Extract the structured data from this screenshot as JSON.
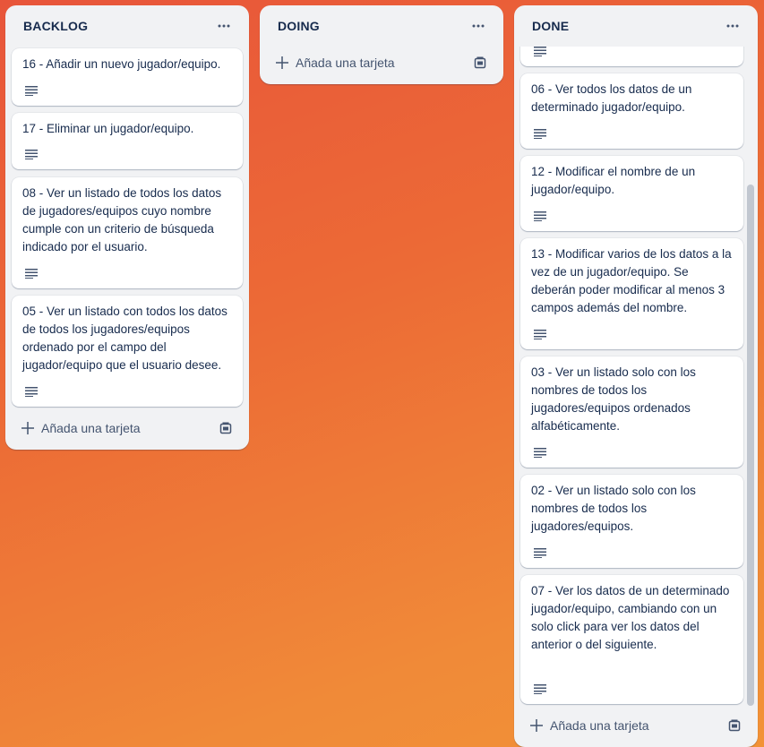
{
  "lists": [
    {
      "title": "BACKLOG",
      "add_label": "Añada una tarjeta",
      "cards": [
        "16 - Añadir un nuevo jugador/equipo.",
        "17 - Eliminar un jugador/equipo.",
        "08 - Ver un listado de todos los datos de jugadores/equipos cuyo nombre cumple con un criterio de búsqueda indicado por el usuario.",
        "05 - Ver un listado con todos los datos de todos los jugadores/equipos ordenado por el campo del jugador/equipo que el usuario desee."
      ]
    },
    {
      "title": "DOING",
      "add_label": "Añada una tarjeta",
      "cards": []
    },
    {
      "title": "DONE",
      "add_label": "Añada una tarjeta",
      "cards": [
        "06 - Ver todos los datos de un determinado jugador/equipo.",
        "12 - Modificar el nombre de un jugador/equipo.",
        "13 - Modificar varios de los datos a la vez de un jugador/equipo. Se deberán poder modificar al menos 3 campos además del nombre.",
        "03 - Ver un listado solo con los nombres de todos los jugadores/equipos ordenados alfabéticamente.",
        "02 - Ver un listado solo con los nombres de todos los jugadores/equipos.",
        "07 - Ver los datos de un determinado jugador/equipo, cambiando con un solo click para ver los datos del anterior o del siguiente."
      ]
    }
  ],
  "icons": {
    "more": "ellipsis-icon",
    "add": "plus-icon",
    "template": "card-template-icon",
    "description": "description-lines-icon"
  },
  "colors": {
    "text": "#172b4d",
    "subtle_text": "#44546f",
    "list_bg": "#f1f2f4",
    "card_bg": "#ffffff"
  }
}
